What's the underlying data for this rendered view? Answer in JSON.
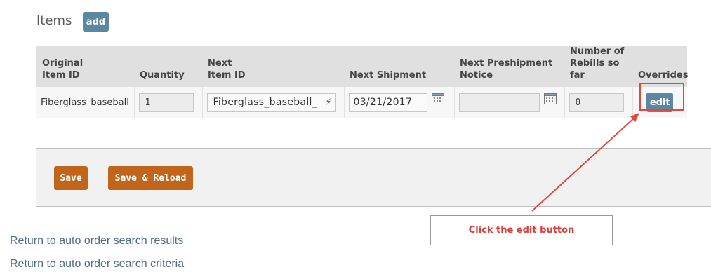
{
  "section": {
    "title": "Items",
    "add_label": "add"
  },
  "table": {
    "headers": {
      "original_item_id": "Original\nItem ID",
      "quantity": "Quantity",
      "next_item_id": "Next\nItem ID",
      "next_shipment": "Next Shipment",
      "next_preshipment_notice": "Next Preshipment\nNotice",
      "number_of_rebills": "Number of\nRebills so far",
      "overrides": "Overrides"
    },
    "row": {
      "original_item_id": "Fiberglass_baseball_",
      "quantity": "1",
      "next_item_id": "Fiberglass_baseball_",
      "next_shipment": "03/21/2017",
      "next_preshipment_notice": "",
      "number_of_rebills": "0",
      "edit_label": "edit"
    }
  },
  "actions": {
    "save_label": "Save",
    "save_reload_label": "Save & Reload"
  },
  "links": {
    "return_results": "Return to auto order search results",
    "return_criteria": "Return to auto order search criteria"
  },
  "annotation": {
    "callout_text": "Click the edit button",
    "color": "#e0483f"
  },
  "colors": {
    "accent_blue": "#5b87a3",
    "accent_orange": "#c0651a"
  }
}
